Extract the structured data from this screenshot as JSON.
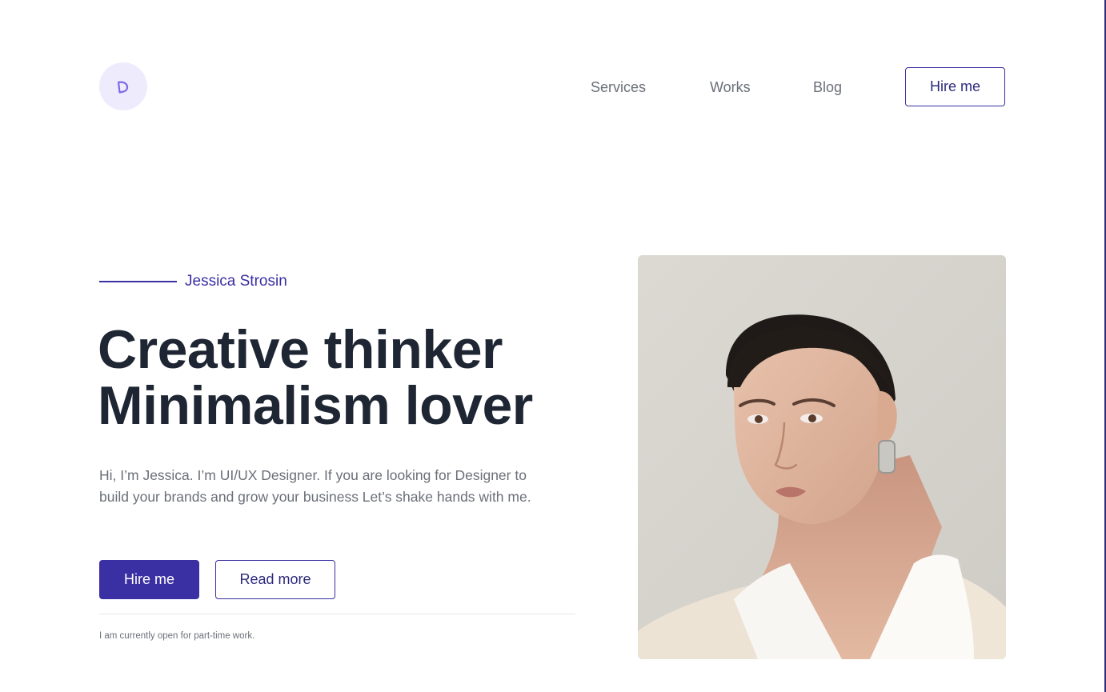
{
  "header": {
    "logo_icon": "d-letter-icon",
    "nav": [
      {
        "label": "Services"
      },
      {
        "label": "Works"
      },
      {
        "label": "Blog"
      }
    ],
    "cta_label": "Hire me"
  },
  "hero": {
    "name": "Jessica Strosin",
    "headline_line1": "Creative thinker",
    "headline_line2": "Minimalism lover",
    "intro": "Hi, I’m Jessica. I’m UI/UX Designer. If you are looking for Designer to build your brands and grow your business Let’s shake hands with me.",
    "primary_button": "Hire me",
    "secondary_button": "Read more",
    "availability": "I am currently open for part-time work."
  },
  "colors": {
    "accent": "#3a2fa3",
    "heading": "#1f2633",
    "body_text": "#6b6f78",
    "logo_bg": "#eeebfd"
  }
}
